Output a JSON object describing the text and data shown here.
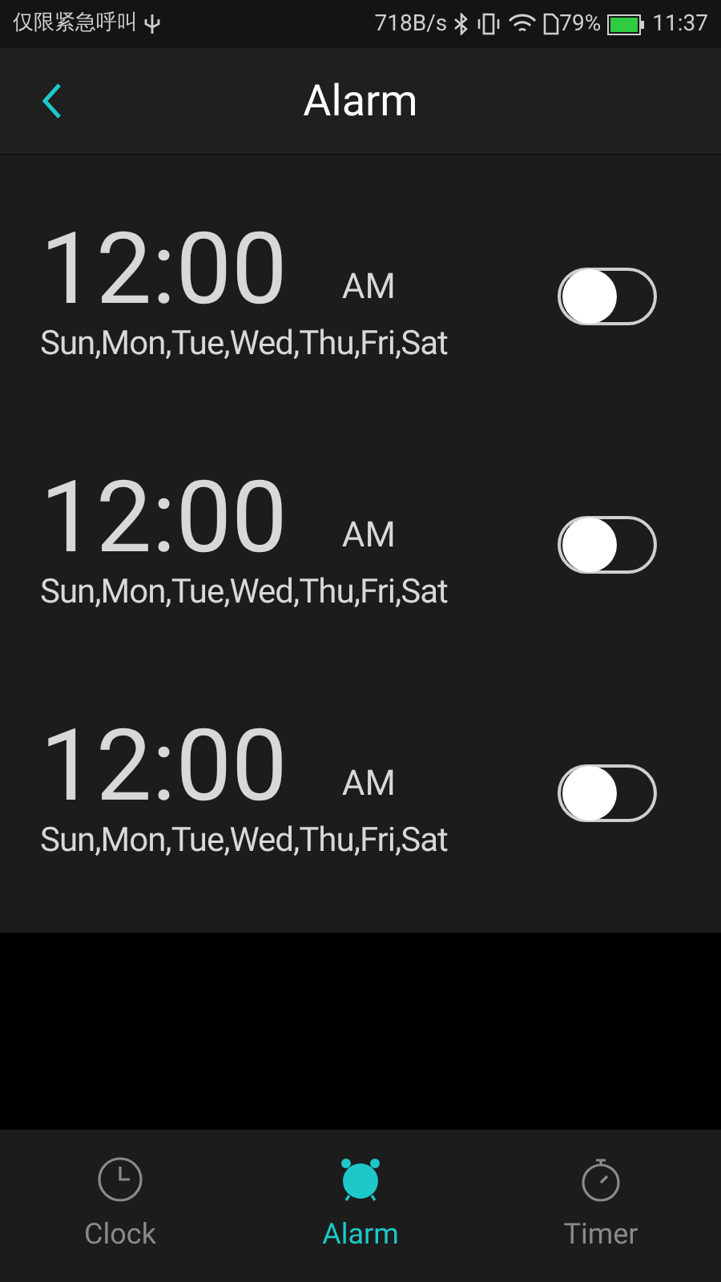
{
  "status_bar": {
    "carrier": "仅限紧急呼叫",
    "speed": "718B/s",
    "battery": "79%",
    "time": "11:37"
  },
  "header": {
    "title": "Alarm"
  },
  "alarms": [
    {
      "time": "12:00",
      "period": "AM",
      "days": "Sun,Mon,Tue,Wed,Thu,Fri,Sat",
      "on": false
    },
    {
      "time": "12:00",
      "period": "AM",
      "days": "Sun,Mon,Tue,Wed,Thu,Fri,Sat",
      "on": false
    },
    {
      "time": "12:00",
      "period": "AM",
      "days": "Sun,Mon,Tue,Wed,Thu,Fri,Sat",
      "on": false
    }
  ],
  "tabs": [
    {
      "label": "Clock",
      "kind": "clock",
      "selected": false
    },
    {
      "label": "Alarm",
      "kind": "alarm",
      "selected": true
    },
    {
      "label": "Timer",
      "kind": "timer",
      "selected": false
    }
  ]
}
